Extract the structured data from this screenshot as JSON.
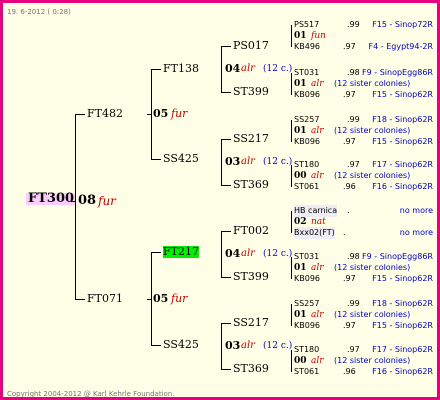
{
  "date": "19. 6-2012 ( 0:28)",
  "copyright": "Copyright 2004-2012 @ Karl Kehrle Foundation.",
  "chart_data": {
    "type": "table",
    "root": {
      "name": "FT300",
      "gen": "08",
      "race": "fur"
    },
    "gen1": [
      {
        "name": "FT482",
        "gen": "05",
        "race": "fur"
      },
      {
        "name": "FT071",
        "gen": "05",
        "race": "fur"
      }
    ],
    "gen2": [
      {
        "name": "FT138",
        "gen": "04",
        "race": "alr",
        "sis": "(12 c.)"
      },
      {
        "name": "SS425",
        "gen": "03",
        "race": "alr",
        "sis": "(12 c.)"
      },
      {
        "name": "FT217",
        "gen": "04",
        "race": "alr",
        "sis": "(12 c.)"
      },
      {
        "name": "SS425",
        "gen": "03",
        "race": "alr",
        "sis": "(12 c.)"
      }
    ],
    "gen3": [
      "PS017",
      "ST399",
      "SS217",
      "ST369",
      "FT002",
      "ST399",
      "SS217",
      "ST369"
    ],
    "gen4": [
      [
        {
          "name": "PS517",
          "num": ".99",
          "link": "F15 - Sinop72R"
        },
        {
          "gen": "01",
          "race": "fun",
          "sis": ""
        },
        {
          "name": "KB496",
          "num": ".97",
          "link": "F4 - Egypt94-2R"
        }
      ],
      [
        {
          "name": "ST031",
          "num": ".98",
          "link": "F9 - SinopEgg86R"
        },
        {
          "gen": "01",
          "race": "alr",
          "sis": "(12 sister colonies)"
        },
        {
          "name": "KB096",
          "num": ".97",
          "link": "F15 - Sinop62R"
        }
      ],
      [
        {
          "name": "SS257",
          "num": ".99",
          "link": "F18 - Sinop62R"
        },
        {
          "gen": "01",
          "race": "alr",
          "sis": "(12 sister colonies)"
        },
        {
          "name": "KB096",
          "num": ".97",
          "link": "F15 - Sinop62R"
        }
      ],
      [
        {
          "name": "ST180",
          "num": ".97",
          "link": "F17 - Sinop62R"
        },
        {
          "gen": "00",
          "race": "alr",
          "sis": "(12 sister colonies)"
        },
        {
          "name": "ST061",
          "num": ".96",
          "link": "F16 - Sinop62R"
        }
      ],
      [
        {
          "name": "HB carnica",
          "num": ".",
          "link": "no more"
        },
        {
          "gen": "02",
          "race": "nat",
          "sis": ""
        },
        {
          "name": "Bxx02(FT)",
          "num": ".",
          "link": "no more"
        }
      ],
      [
        {
          "name": "ST031",
          "num": ".98",
          "link": "F9 - SinopEgg86R"
        },
        {
          "gen": "01",
          "race": "alr",
          "sis": "(12 sister colonies)"
        },
        {
          "name": "KB096",
          "num": ".97",
          "link": "F15 - Sinop62R"
        }
      ],
      [
        {
          "name": "SS257",
          "num": ".99",
          "link": "F18 - Sinop62R"
        },
        {
          "gen": "01",
          "race": "alr",
          "sis": "(12 sister colonies)"
        },
        {
          "name": "KB096",
          "num": ".97",
          "link": "F15 - Sinop62R"
        }
      ],
      [
        {
          "name": "ST180",
          "num": ".97",
          "link": "F17 - Sinop62R"
        },
        {
          "gen": "00",
          "race": "alr",
          "sis": "(12 sister colonies)"
        },
        {
          "name": "ST061",
          "num": ".96",
          "link": "F16 - Sinop62R"
        }
      ]
    ]
  }
}
